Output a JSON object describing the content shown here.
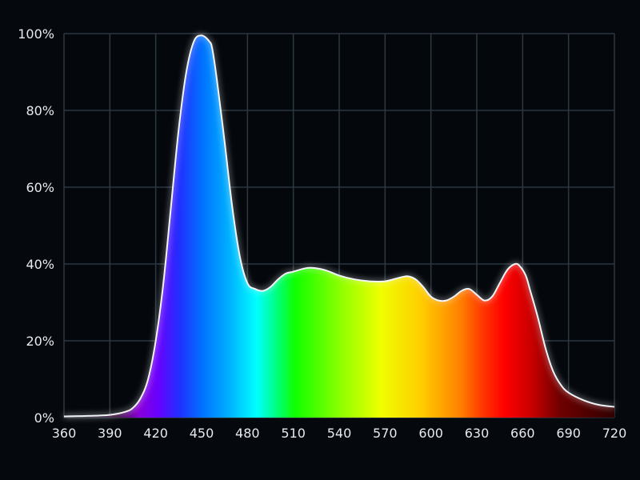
{
  "chart_data": {
    "type": "area",
    "title": "",
    "xlabel": "",
    "ylabel": "",
    "x_ticks": [
      "360",
      "390",
      "420",
      "450",
      "480",
      "510",
      "540",
      "570",
      "600",
      "630",
      "660",
      "690",
      "720"
    ],
    "y_ticks": [
      "0%",
      "20%",
      "40%",
      "60%",
      "80%",
      "100%"
    ],
    "xlim": [
      360,
      720
    ],
    "ylim": [
      0,
      100
    ],
    "grid": true,
    "fill": "visible-spectrum gradient by wavelength",
    "line_color": "#f2f4f7",
    "background_color": "#05080c",
    "series": [
      {
        "x": [
          360,
          370,
          380,
          390,
          400,
          405,
          410,
          415,
          420,
          425,
          430,
          435,
          440,
          445,
          450,
          455,
          457,
          460,
          465,
          470,
          475,
          480,
          485,
          490,
          495,
          500,
          505,
          510,
          520,
          530,
          540,
          550,
          560,
          570,
          580,
          585,
          590,
          595,
          600,
          605,
          610,
          615,
          620,
          625,
          630,
          635,
          640,
          645,
          650,
          655,
          658,
          662,
          665,
          670,
          675,
          680,
          685,
          690,
          700,
          710,
          720
        ],
        "values": [
          0.3,
          0.4,
          0.5,
          0.7,
          1.5,
          2.5,
          5,
          10,
          20,
          35,
          55,
          75,
          90,
          98,
          99.5,
          98,
          96,
          88,
          72,
          55,
          42,
          35,
          33.5,
          33,
          34,
          36,
          37.5,
          38,
          39,
          38.5,
          37,
          36,
          35.5,
          35.5,
          36.5,
          36.8,
          36,
          34,
          31.5,
          30.5,
          30.5,
          31.5,
          33,
          33.5,
          32,
          30.5,
          31.5,
          35,
          38.5,
          40,
          39.5,
          37,
          33,
          26,
          18,
          12,
          8.5,
          6.5,
          4.5,
          3.3,
          2.8
        ]
      }
    ]
  }
}
